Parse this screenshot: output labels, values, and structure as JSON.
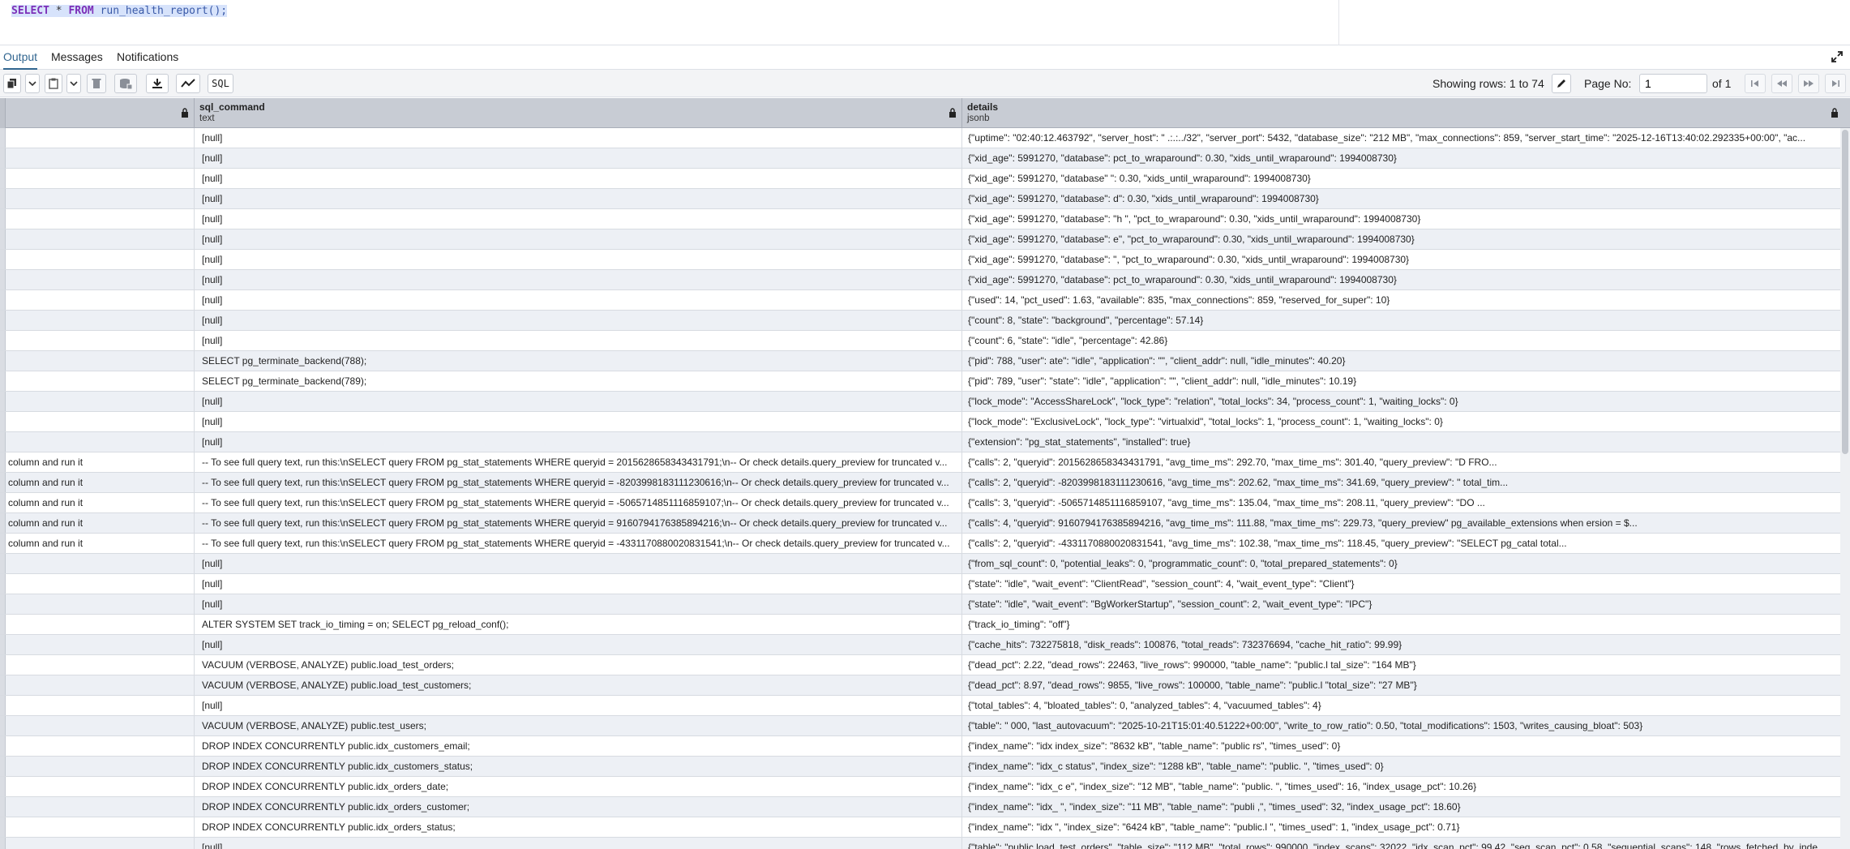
{
  "editor": {
    "kw_select": "SELECT",
    "star": "*",
    "kw_from": "FROM",
    "call": "run_health_report();"
  },
  "tabs": {
    "output": "Output",
    "messages": "Messages",
    "notifications": "Notifications"
  },
  "toolbar": {
    "sql_label": "SQL",
    "rows_info": "Showing rows: 1 to 74",
    "page_label": "Page No:",
    "page_value": "1",
    "of_pages": "of 1"
  },
  "columns": [
    {
      "name": "",
      "type": ""
    },
    {
      "name": "sql_command",
      "type": "text"
    },
    {
      "name": "details",
      "type": "jsonb"
    }
  ],
  "rows": [
    [
      "",
      "[null]",
      "{\"uptime\": \"02:40:12.463792\", \"server_host\": \"          .:.:../32\", \"server_port\": 5432, \"database_size\": \"212 MB\", \"max_connections\": 859, \"server_start_time\": \"2025-12-16T13:40:02.292335+00:00\", \"ac..."
    ],
    [
      "",
      "[null]",
      "{\"xid_age\": 5991270, \"database\":                    pct_to_wraparound\": 0.30, \"xids_until_wraparound\": 1994008730}"
    ],
    [
      "",
      "[null]",
      "{\"xid_age\": 5991270, \"database\"                                    \": 0.30, \"xids_until_wraparound\": 1994008730}"
    ],
    [
      "",
      "[null]",
      "{\"xid_age\": 5991270, \"database\":                                    d\": 0.30, \"xids_until_wraparound\": 1994008730}"
    ],
    [
      "",
      "[null]",
      "{\"xid_age\": 5991270, \"database\": \"h                  \", \"pct_to_wraparound\": 0.30, \"xids_until_wraparound\": 1994008730}"
    ],
    [
      "",
      "[null]",
      "{\"xid_age\": 5991270, \"database\":                          e\", \"pct_to_wraparound\": 0.30, \"xids_until_wraparound\": 1994008730}"
    ],
    [
      "",
      "[null]",
      "{\"xid_age\": 5991270, \"database\":                 \", \"pct_to_wraparound\": 0.30, \"xids_until_wraparound\": 1994008730}"
    ],
    [
      "",
      "[null]",
      "{\"xid_age\": 5991270, \"database\":               pct_to_wraparound\": 0.30, \"xids_until_wraparound\": 1994008730}"
    ],
    [
      "",
      "[null]",
      "{\"used\": 14, \"pct_used\": 1.63, \"available\": 835, \"max_connections\": 859, \"reserved_for_super\": 10}"
    ],
    [
      "",
      "[null]",
      "{\"count\": 8, \"state\": \"background\", \"percentage\": 57.14}"
    ],
    [
      "",
      "[null]",
      "{\"count\": 6, \"state\": \"idle\", \"percentage\": 42.86}"
    ],
    [
      "",
      "SELECT pg_terminate_backend(788);",
      "{\"pid\": 788, \"user\":                  ate\": \"idle\", \"application\": \"\", \"client_addr\": null, \"idle_minutes\": 40.20}"
    ],
    [
      "",
      "SELECT pg_terminate_backend(789);",
      "{\"pid\": 789, \"user\":             \"state\": \"idle\", \"application\": \"\", \"client_addr\": null, \"idle_minutes\": 10.19}"
    ],
    [
      "",
      "[null]",
      "{\"lock_mode\": \"AccessShareLock\", \"lock_type\": \"relation\", \"total_locks\": 34, \"process_count\": 1, \"waiting_locks\": 0}"
    ],
    [
      "",
      "[null]",
      "{\"lock_mode\": \"ExclusiveLock\", \"lock_type\": \"virtualxid\", \"total_locks\": 1, \"process_count\": 1, \"waiting_locks\": 0}"
    ],
    [
      "",
      "[null]",
      "{\"extension\": \"pg_stat_statements\", \"installed\": true}"
    ],
    [
      "column and run it",
      "-- To see full query text, run this:\\nSELECT query FROM pg_stat_statements WHERE queryid = 2015628658343431791;\\n-- Or check details.query_preview for truncated v...",
      "{\"calls\": 2, \"queryid\": 2015628658343431791, \"avg_time_ms\": 292.70, \"max_time_ms\": 301.40, \"query_preview\": \"D                                                                        FRO..."
    ],
    [
      "column and run it",
      "-- To see full query text, run this:\\nSELECT query FROM pg_stat_statements WHERE queryid = -8203998183111230616;\\n-- Or check details.query_preview for truncated v...",
      "{\"calls\": 2, \"queryid\": -8203998183111230616, \"avg_time_ms\": 202.62, \"max_time_ms\": 341.69, \"query_preview\": \"                                                                       total_tim..."
    ],
    [
      "column and run it",
      "-- To see full query text, run this:\\nSELECT query FROM pg_stat_statements WHERE queryid = -5065714851116859107;\\n-- Or check details.query_preview for truncated v...",
      "{\"calls\": 3, \"queryid\": -5065714851116859107, \"avg_time_ms\": 135.04, \"max_time_ms\": 208.11, \"query_preview\": \"DO                                                                           ..."
    ],
    [
      "column and run it",
      "-- To see full query text, run this:\\nSELECT query FROM pg_stat_statements WHERE queryid = 9160794176385894216;\\n-- Or check details.query_preview for truncated v...",
      "{\"calls\": 4, \"queryid\": 9160794176385894216, \"avg_time_ms\": 111.88, \"max_time_ms\": 229.73, \"query_preview\"          pg_available_extensions when                          ersion = $..."
    ],
    [
      "column and run it",
      "-- To see full query text, run this:\\nSELECT query FROM pg_stat_statements WHERE queryid = -4331170880020831541;\\n-- Or check details.query_preview for truncated v...",
      "{\"calls\": 2, \"queryid\": -4331170880020831541, \"avg_time_ms\": 102.38, \"max_time_ms\": 118.45, \"query_preview\": \"SELECT pg_catal                                                    total..."
    ],
    [
      "",
      "[null]",
      "{\"from_sql_count\": 0, \"potential_leaks\": 0, \"programmatic_count\": 0, \"total_prepared_statements\": 0}"
    ],
    [
      "",
      "[null]",
      "{\"state\": \"idle\", \"wait_event\": \"ClientRead\", \"session_count\": 4, \"wait_event_type\": \"Client\"}"
    ],
    [
      "",
      "[null]",
      "{\"state\": \"idle\", \"wait_event\": \"BgWorkerStartup\", \"session_count\": 2, \"wait_event_type\": \"IPC\"}"
    ],
    [
      "",
      "ALTER SYSTEM SET track_io_timing = on; SELECT pg_reload_conf();",
      "{\"track_io_timing\": \"off\"}"
    ],
    [
      "",
      "[null]",
      "{\"cache_hits\": 732275818, \"disk_reads\": 100876, \"total_reads\": 732376694, \"cache_hit_ratio\": 99.99}"
    ],
    [
      "",
      "VACUUM (VERBOSE, ANALYZE) public.load_test_orders;",
      "{\"dead_pct\": 2.22, \"dead_rows\": 22463, \"live_rows\": 990000, \"table_name\": \"public.l                     tal_size\": \"164 MB\"}"
    ],
    [
      "",
      "VACUUM (VERBOSE, ANALYZE) public.load_test_customers;",
      "{\"dead_pct\": 8.97, \"dead_rows\": 9855, \"live_rows\": 100000, \"table_name\": \"public.l                   \"total_size\": \"27 MB\"}"
    ],
    [
      "",
      "[null]",
      "{\"total_tables\": 4, \"bloated_tables\": 0, \"analyzed_tables\": 4, \"vacuumed_tables\": 4}"
    ],
    [
      "",
      "VACUUM (VERBOSE, ANALYZE) public.test_users;",
      "{\"table\": \"                              000, \"last_autovacuum\": \"2025-10-21T15:01:40.51222+00:00\", \"write_to_row_ratio\": 0.50, \"total_modifications\": 1503, \"writes_causing_bloat\": 503}"
    ],
    [
      "",
      "DROP INDEX CONCURRENTLY public.idx_customers_email;",
      "{\"index_name\": \"idx                   index_size\": \"8632 kB\", \"table_name\": \"public                      rs\", \"times_used\": 0}"
    ],
    [
      "",
      "DROP INDEX CONCURRENTLY public.idx_customers_status;",
      "{\"index_name\": \"idx_c           status\", \"index_size\": \"1288 kB\", \"table_name\": \"public.                         \", \"times_used\": 0}"
    ],
    [
      "",
      "DROP INDEX CONCURRENTLY public.idx_orders_date;",
      "{\"index_name\": \"idx_c          e\", \"index_size\": \"12 MB\", \"table_name\": \"public.                     \", \"times_used\": 16, \"index_usage_pct\": 10.26}"
    ],
    [
      "",
      "DROP INDEX CONCURRENTLY public.idx_orders_customer;",
      "{\"index_name\": \"idx_                \", \"index_size\": \"11 MB\", \"table_name\": \"publi                   ,\", \"times_used\": 32, \"index_usage_pct\": 18.60}"
    ],
    [
      "",
      "DROP INDEX CONCURRENTLY public.idx_orders_status;",
      "{\"index_name\": \"idx                 \", \"index_size\": \"6424 kB\", \"table_name\": \"public.l                  \", \"times_used\": 1, \"index_usage_pct\": 0.71}"
    ],
    [
      "",
      "[null]",
      "{\"table\": \"public.load_test_orders\", \"table_size\": \"112 MB\", \"total_rows\": 990000, \"index_scans\": 32022, \"idx_scan_pct\": 99.42, \"seq_scan_pct\": 0.58, \"sequential_scans\": 148, \"rows_fetched_by_inde..."
    ]
  ]
}
